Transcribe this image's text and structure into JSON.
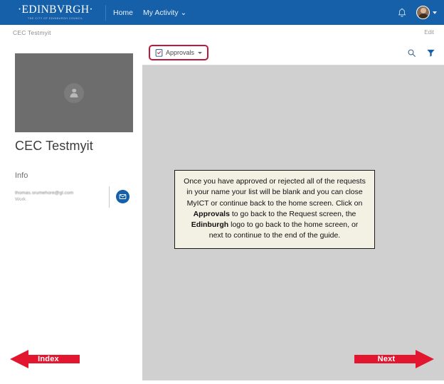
{
  "header": {
    "brand_word": "·EDINBVRGH·",
    "brand_sub": "THE CITY OF EDINBURGH COUNCIL",
    "nav": [
      {
        "label": "Home"
      },
      {
        "label": "My Activity ⌄"
      }
    ],
    "bell_icon": "bell-icon",
    "avatar_icon": "user-avatar",
    "accent_blue": "#1560a8"
  },
  "breadcrumb": {
    "text": "CEC Testmyit",
    "edit_label": "Edit"
  },
  "profile": {
    "photo_placeholder_icon": "person-placeholder-icon",
    "name": "CEC Testmyit",
    "info_heading": "Info",
    "email": "thomas.srumehore@gl.com",
    "email_type": "Work",
    "mail_button_icon": "envelope-icon"
  },
  "toolbar": {
    "approvals_label": "Approvals",
    "approvals_icon": "clipboard-check-icon",
    "chevron_icon": "chevron-down-icon",
    "search_icon": "search-icon",
    "filter_icon": "filter-icon",
    "highlight_color": "#c0173c"
  },
  "callout": {
    "part1": "Once you have approved or rejected all of the requests in your name your list will be blank and you can close MyICT or continue back to the home screen. Click on ",
    "bold1": "Approvals",
    "part2": " to go back to the Request screen, the ",
    "bold2": "Edinburgh",
    "part3": " logo to go back to the home screen, or next to continue to the end of the guide."
  },
  "navigation": {
    "prev_label": "Index",
    "next_label": "Next",
    "arrow_color": "#e2172f"
  }
}
